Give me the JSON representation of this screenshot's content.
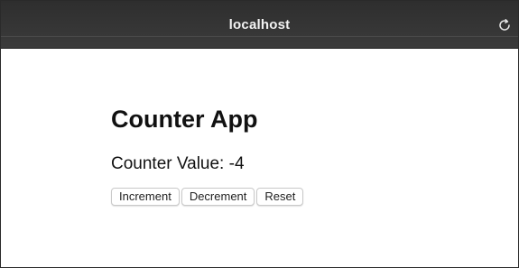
{
  "browser": {
    "url": "localhost",
    "reload_icon": "reload-icon"
  },
  "app": {
    "title": "Counter App",
    "counter_label": "Counter Value:",
    "counter_value": "-4"
  },
  "buttons": {
    "increment": "Increment",
    "decrement": "Decrement",
    "reset": "Reset"
  }
}
